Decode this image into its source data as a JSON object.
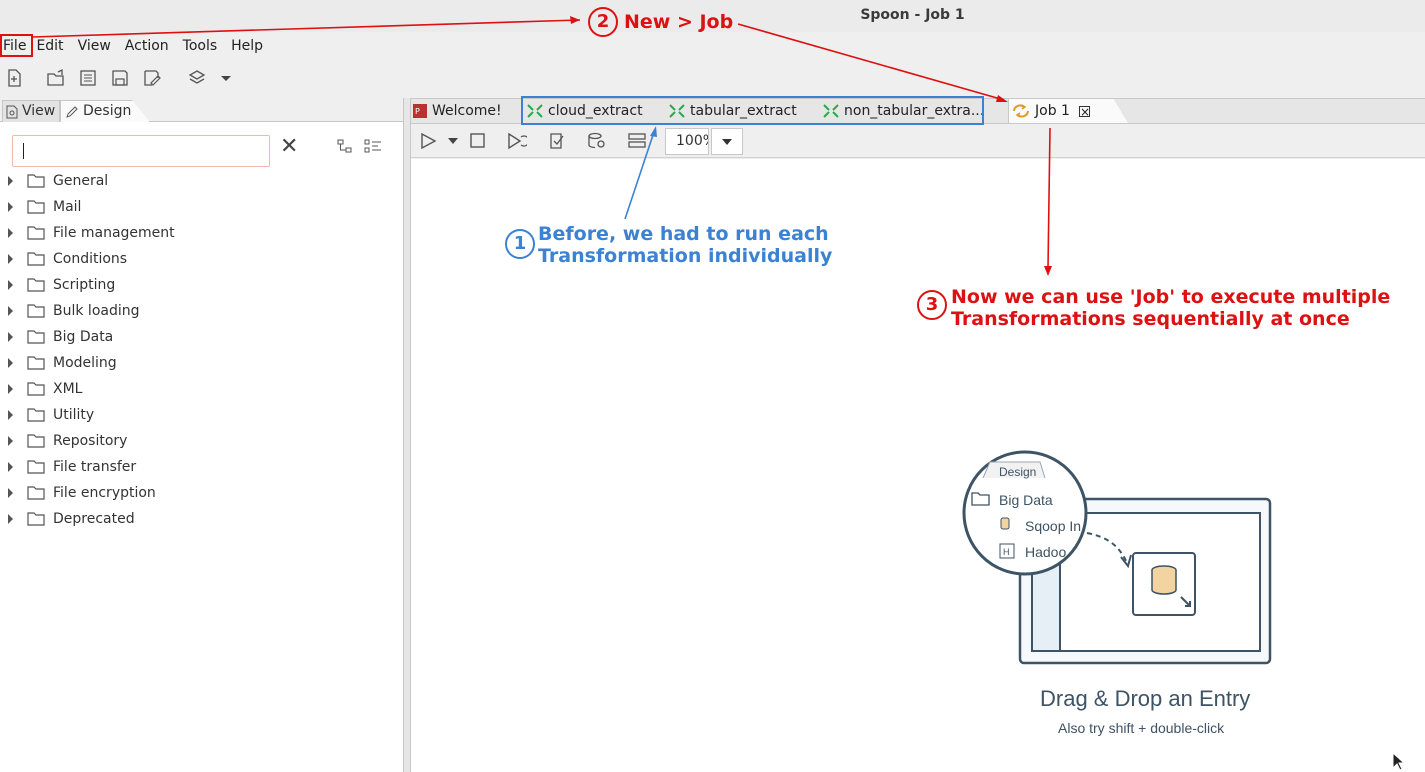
{
  "window": {
    "title": "Spoon - Job 1"
  },
  "menu": [
    "File",
    "Edit",
    "View",
    "Action",
    "Tools",
    "Help"
  ],
  "left_tabs": {
    "view": "View",
    "design": "Design"
  },
  "search": {
    "value": "",
    "placeholder": ""
  },
  "tree": [
    "General",
    "Mail",
    "File management",
    "Conditions",
    "Scripting",
    "Bulk loading",
    "Big Data",
    "Modeling",
    "XML",
    "Utility",
    "Repository",
    "File transfer",
    "File encryption",
    "Deprecated"
  ],
  "editor_tabs": {
    "welcome": "Welcome!",
    "cloud": "cloud_extract",
    "tabular": "tabular_extract",
    "nontabular": "non_tabular_extra...",
    "job": "Job 1"
  },
  "zoom": "100%",
  "illustration": {
    "tab": "Design",
    "folder": "Big Data",
    "item1": "Sqoop In",
    "item2": "Hadoo"
  },
  "drag_drop": {
    "title": "Drag & Drop an Entry",
    "subtitle": "Also try shift + double-click"
  },
  "annotations": {
    "step1": {
      "num": "1",
      "line1": "Before, we had to run each",
      "line2": "Transformation individually"
    },
    "step2": {
      "num": "2",
      "text": "New > Job"
    },
    "step3": {
      "num": "3",
      "line1": "Now we can use 'Job' to execute multiple",
      "line2": "Transformations sequentially at once"
    }
  },
  "colors": {
    "annotation_red": "#dd1111",
    "annotation_blue": "#3b82d4",
    "illustration": "#3d5366"
  }
}
